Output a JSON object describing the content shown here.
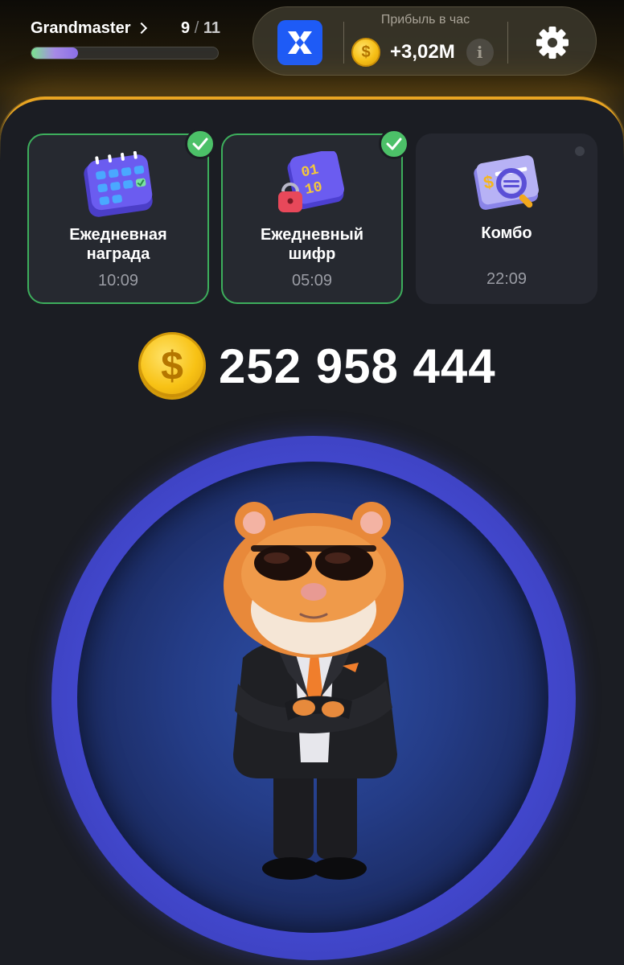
{
  "header": {
    "level_name": "Grandmaster",
    "level_current": "9",
    "level_separator": " / ",
    "level_total": "11",
    "level_progress": 0.25,
    "profit_label": "Прибыль в час",
    "profit_value": "+3,02M",
    "coin_symbol": "$",
    "info_symbol": "i",
    "exchange_icon": "exchange-x-logo-icon",
    "settings_icon": "gear-icon"
  },
  "cards": [
    {
      "title": "Ежедневная\nнаграда",
      "time": "10:09",
      "completed": true,
      "icon": "calendar-icon"
    },
    {
      "title": "Ежедневный\nшифр",
      "time": "05:09",
      "completed": true,
      "icon": "cipher-lock-icon"
    },
    {
      "title": "Комбо",
      "time": "22:09",
      "completed": false,
      "icon": "combo-card-icon"
    }
  ],
  "balance": {
    "coin_symbol": "$",
    "value": "252 958 444"
  },
  "colors": {
    "accent_gold": "#e8a422",
    "exchange_blue": "#1e5bf6",
    "check_green": "#4cc068",
    "tap_ring": "#4b50dc"
  }
}
